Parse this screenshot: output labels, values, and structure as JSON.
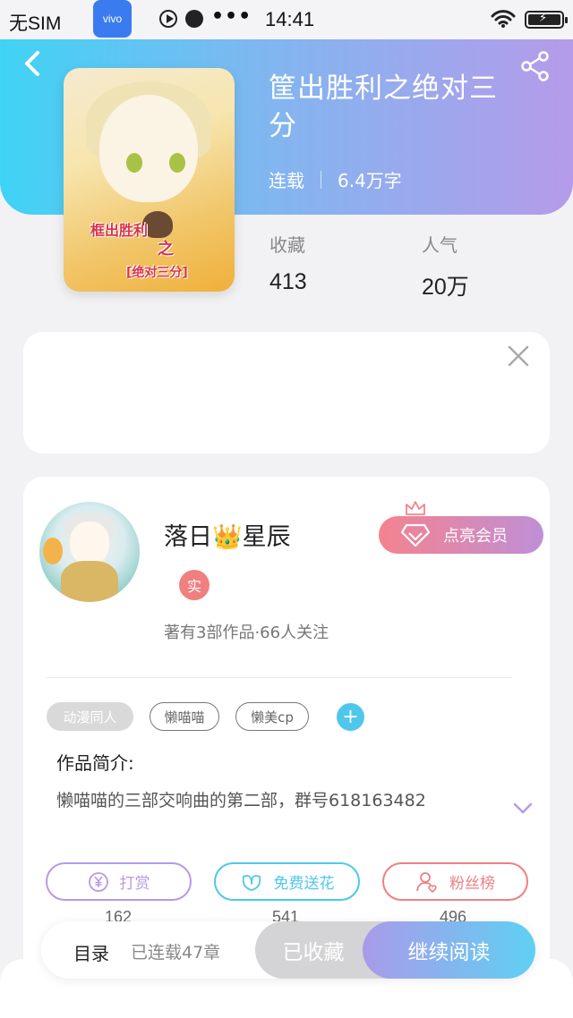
{
  "status_bar": {
    "carrier": "无SIM",
    "app_badge": "vivo",
    "dots": "•••",
    "time": "14:41"
  },
  "book": {
    "title": "筐出胜利之绝对三分",
    "status": "连载",
    "word_count": "6.4万字",
    "collect_label": "收藏",
    "collect_value": "413",
    "popularity_label": "人气",
    "popularity_value": "20万",
    "cover_text_1": "框出胜利",
    "cover_text_2": "之",
    "cover_text_3": "[绝对三分]"
  },
  "author": {
    "name": "落日👑星辰",
    "verify_badge": "实",
    "meta": "著有3部作品·66人关注",
    "vip_button": "点亮会员"
  },
  "tags": [
    {
      "label": "动漫同人",
      "style": "filled"
    },
    {
      "label": "懒喵喵",
      "style": "outline"
    },
    {
      "label": "懒美cp",
      "style": "outline"
    }
  ],
  "intro": {
    "heading": "作品简介:",
    "text": "懒喵喵的三部交响曲的第二部，群号618163482"
  },
  "actions": [
    {
      "label": "打赏",
      "count": "162",
      "color": "#b79ae6",
      "icon": "yuan-icon"
    },
    {
      "label": "免费送花",
      "count": "541",
      "color": "#4fc7ec",
      "icon": "flower-icon"
    },
    {
      "label": "粉丝榜",
      "count": "496",
      "color": "#f07f80",
      "icon": "fans-icon"
    }
  ],
  "bottom": {
    "toc": "目录",
    "toc_count": "已连载47章",
    "favorited": "已收藏",
    "continue": "继续阅读"
  },
  "colors": {
    "hero_start": "#3fd3f5",
    "hero_end": "#b59bea",
    "vip_start": "#f5828e",
    "vip_end": "#bf8fd6"
  }
}
